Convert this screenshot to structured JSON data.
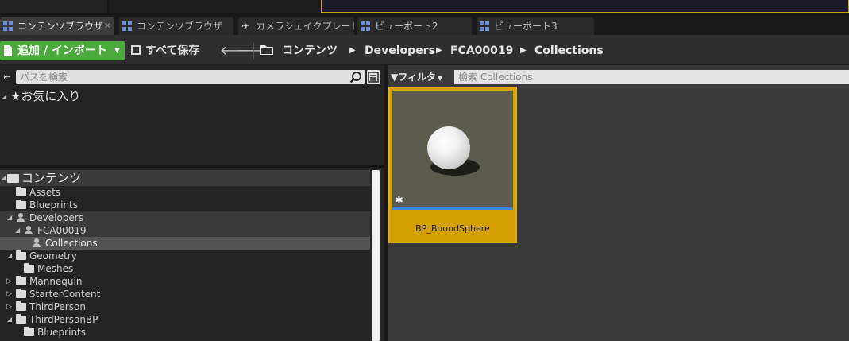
{
  "tabs": [
    {
      "label": "コンテンツブラウザ",
      "icon": "content-browser-icon",
      "active": true
    },
    {
      "label": "コンテンツブラウザ",
      "icon": "content-browser-icon",
      "active": false
    },
    {
      "label": "カメラシェイクプレート",
      "icon": "camera-shake-icon",
      "active": false
    },
    {
      "label": "ビューポート2",
      "icon": "viewport-icon",
      "active": false
    },
    {
      "label": "ビューポート3",
      "icon": "viewport-icon",
      "active": false
    }
  ],
  "toolbar": {
    "add_label": "追加 / インポート",
    "save_all_label": "すべて保存",
    "breadcrumbs": [
      "コンテンツ",
      "Developers",
      "FCA00019",
      "Collections"
    ]
  },
  "sidebar": {
    "search_placeholder": "パスを検索",
    "favorites_label": "お気に入り",
    "tree": {
      "root": "コンテンツ",
      "items": [
        {
          "label": "Assets"
        },
        {
          "label": "Blueprints"
        },
        {
          "label": "Developers"
        },
        {
          "label": "FCA00019"
        },
        {
          "label": "Collections"
        },
        {
          "label": "Geometry"
        },
        {
          "label": "Meshes"
        },
        {
          "label": "Mannequin"
        },
        {
          "label": "StarterContent"
        },
        {
          "label": "ThirdPerson"
        },
        {
          "label": "ThirdPersonBP"
        },
        {
          "label": "Blueprints"
        }
      ]
    }
  },
  "main": {
    "filter_label": "フィルタ",
    "search_placeholder": "検索 Collections",
    "assets": [
      {
        "name": "BP_BoundSphere"
      }
    ]
  },
  "colors": {
    "accent_green": "#4caa3c",
    "selected_tile": "#d4a000",
    "thumbnail_bar": "#3d86e6"
  }
}
